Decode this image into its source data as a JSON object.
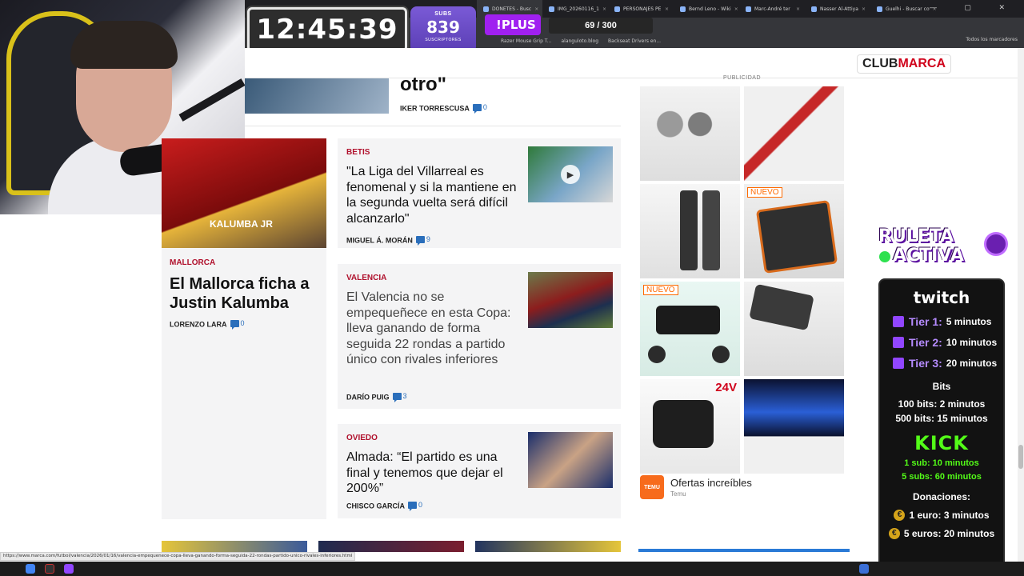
{
  "browser": {
    "tabs": [
      "DONETES - Busc",
      "IMG_20260116_1",
      "PERSONAJES PE",
      "Bernd Leno - Wiki",
      "Marc-André ter",
      "Nasser Al-Attiya",
      "Guelhi - Buscar co"
    ],
    "bookmarks": [
      "Razer Mouse Grip T...",
      "alanguloto.blog",
      "Backseat Drivers en..."
    ],
    "bookmarks_right": "Todos los marcadores",
    "status_url": "https://www.marca.com/futbol/valencia/2026/01/16/valencia-empequenece-copa-lleva-ganando-forma-seguida-22-rondas-partido-unico-rivales-inferiores.html"
  },
  "overlay": {
    "timer": "12:45:39",
    "subs_label": "SUBS",
    "subs_count": "839",
    "subs_sub": "SUSCRIPTORES",
    "plus": "!PLUS",
    "progress": "69 / 300",
    "ruleta_line1": "RULETA",
    "ruleta_line2": "ACTIVA",
    "twitch": "twitch",
    "tiers": [
      {
        "label": "Tier 1:",
        "value": "5 minutos"
      },
      {
        "label": "Tier 2:",
        "value": "10 minutos"
      },
      {
        "label": "Tier 3:",
        "value": "20 minutos"
      }
    ],
    "bits_header": "Bits",
    "bits": [
      "100 bits: 2 minutos",
      "500 bits: 15 minutos"
    ],
    "kick": "KICK",
    "kick_items": [
      "1 sub: 10 minutos",
      "5 subs: 60 minutos"
    ],
    "donations_header": "Donaciones:",
    "donations": [
      "1 euro: 3 minutos",
      "5 euros: 20 minutos"
    ]
  },
  "site": {
    "logo_club": "CLUB",
    "logo_marca": "MARCA",
    "top_item": {
      "title": "otro\"",
      "author": "IKER TORRESCUSA",
      "comments": "0"
    },
    "left_article": {
      "section": "MALLORCA",
      "title": "El Mallorca ficha a Justin Kalumba",
      "author": "LORENZO LARA",
      "comments": "0",
      "image_text": "KALUMBA JR"
    },
    "articles": [
      {
        "section": "BETIS",
        "title": "\"La Liga del Villarreal es fenomenal y si la mantiene en la segunda vuelta será difícil alcanzarlo\"",
        "author": "MIGUEL Á. MORÁN",
        "comments": "9"
      },
      {
        "section": "VALENCIA",
        "title": "El Valencia no se empequeñece en esta Copa: lleva ganando de forma seguida 22 rondas a partido único con rivales inferiores",
        "author": "DARÍO PUIG",
        "comments": "3"
      },
      {
        "section": "OVIEDO",
        "title": "Almada: “El partido es una final y tenemos que dejar el 200%”",
        "author": "CHISCO GARCÍA",
        "comments": "0"
      }
    ]
  },
  "ad": {
    "label": "PUBLICIDAD",
    "tag_new": "NUEVO",
    "tag_24v": "24V",
    "brand_title": "Ofertas increíbles",
    "brand_sub": "Temu",
    "brand_logo": "TEMU"
  }
}
